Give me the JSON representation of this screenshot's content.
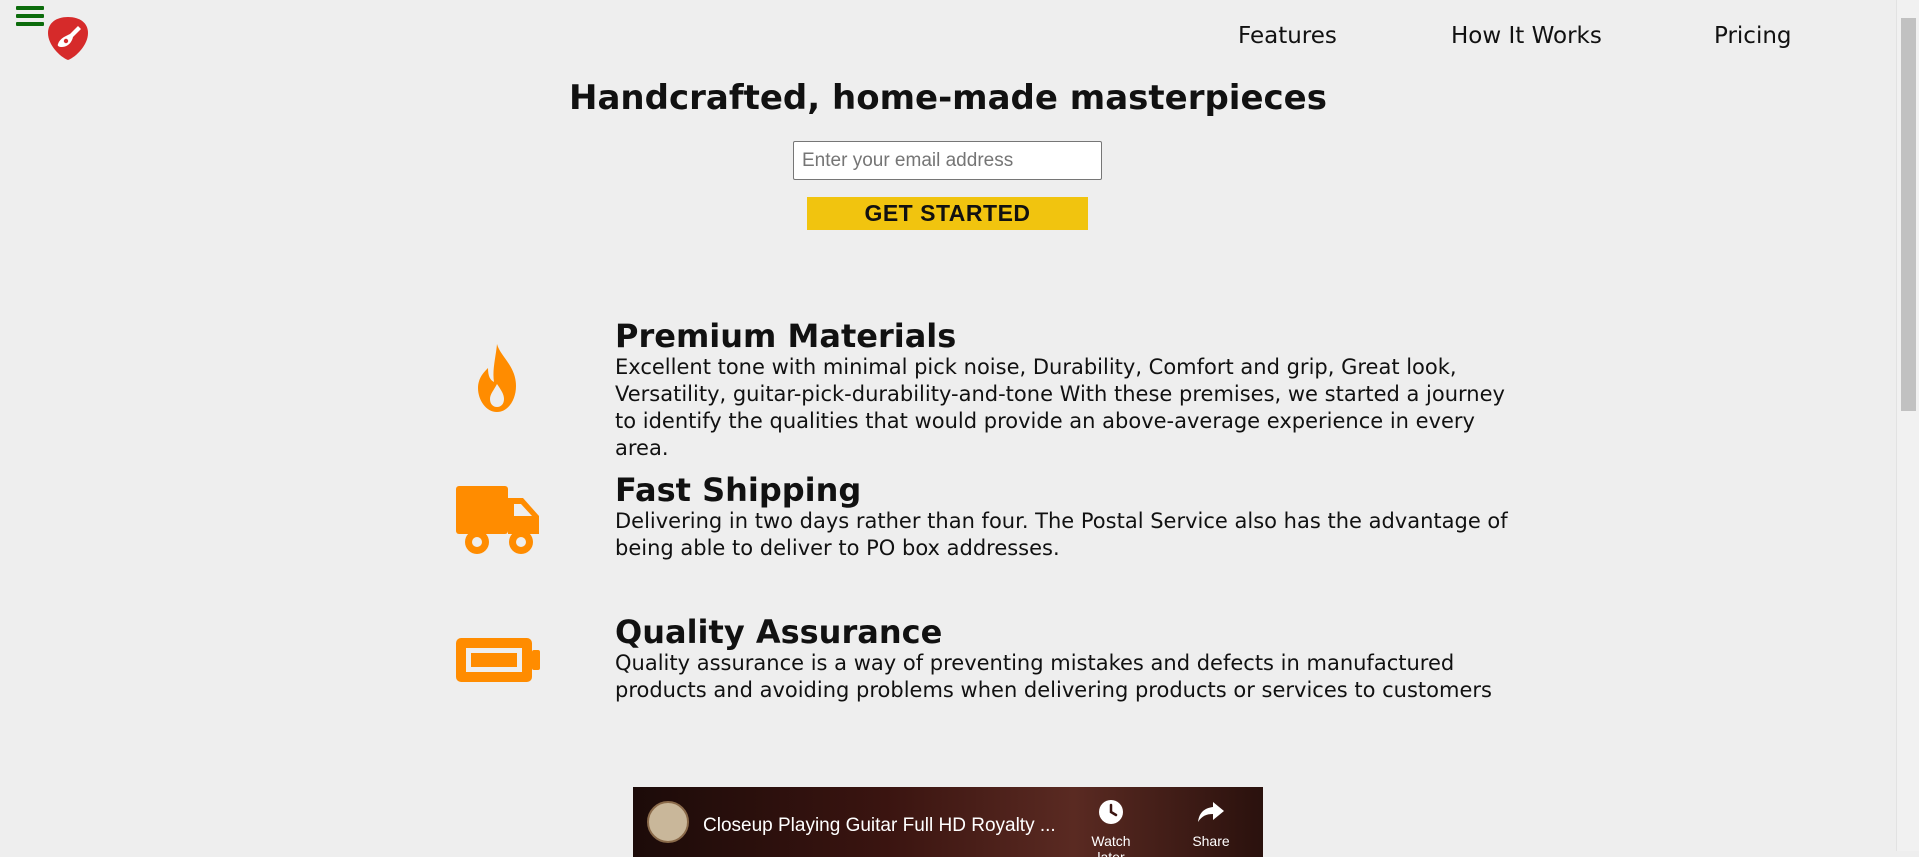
{
  "header": {
    "menu_icon": "hamburger-menu-icon",
    "logo_icon": "guitar-pick-logo-icon",
    "nav": [
      "Features",
      "How It Works",
      "Pricing"
    ]
  },
  "hero": {
    "title": "Handcrafted, home-made masterpieces",
    "email_placeholder": "Enter your email address",
    "cta_label": "GET STARTED"
  },
  "features": [
    {
      "icon": "fire-icon",
      "title": "Premium Materials",
      "text": "Excellent tone with minimal pick noise, Durability, Comfort and grip, Great look, Versatility, guitar-pick-durability-and-tone With these premises, we started a journey to identify the qualities that would provide an above-average experience in every area."
    },
    {
      "icon": "truck-icon",
      "title": "Fast Shipping",
      "text": "Delivering in two days rather than four. The Postal Service also has the advantage of being able to deliver to PO box addresses."
    },
    {
      "icon": "battery-icon",
      "title": "Quality Assurance",
      "text": "Quality assurance is a way of preventing mistakes and defects in manufactured products and avoiding problems when delivering products or services to customers"
    }
  ],
  "video": {
    "title": "Closeup Playing Guitar Full HD Royalty ...",
    "watch_later": "Watch later",
    "share": "Share"
  },
  "colors": {
    "accent": "#ff8c00",
    "cta": "#f1c40f",
    "menu": "#0b6b0b",
    "logo": "#d62a2a",
    "background": "#eeeeee"
  }
}
